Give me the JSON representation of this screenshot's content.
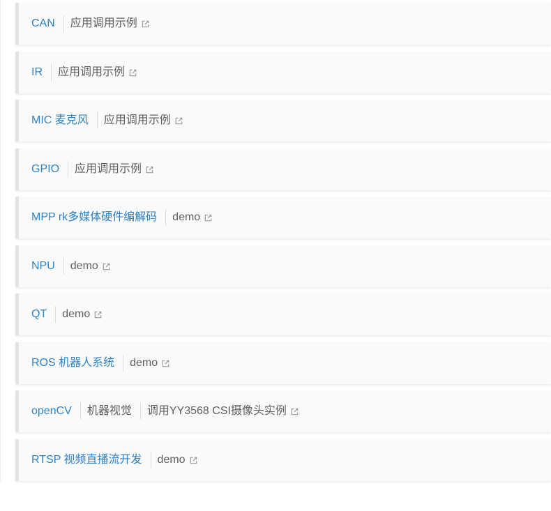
{
  "items": [
    {
      "title": "CAN",
      "parts": [
        {
          "text": "应用调用示例"
        }
      ]
    },
    {
      "title": "IR",
      "parts": [
        {
          "text": "应用调用示例"
        }
      ]
    },
    {
      "title": "MIC 麦克风",
      "parts": [
        {
          "text": "应用调用示例"
        }
      ]
    },
    {
      "title": "GPIO",
      "parts": [
        {
          "text": "应用调用示例"
        }
      ]
    },
    {
      "title": "MPP rk多媒体硬件编解码",
      "parts": [
        {
          "text": "demo"
        }
      ]
    },
    {
      "title": "NPU",
      "parts": [
        {
          "text": "demo"
        }
      ]
    },
    {
      "title": "QT",
      "parts": [
        {
          "text": "demo"
        }
      ]
    },
    {
      "title": "ROS 机器人系统",
      "parts": [
        {
          "text": "demo"
        }
      ]
    },
    {
      "title": "openCV",
      "parts": [
        {
          "text": "机器视觉"
        },
        {
          "text": "调用YY3568 CSI摄像头实例"
        }
      ]
    },
    {
      "title": "RTSP 视频直播流开发",
      "parts": [
        {
          "text": "demo"
        }
      ]
    }
  ],
  "icons": {
    "external": "external-link-icon"
  },
  "colors": {
    "link": "#2d82c8",
    "text": "#5f5f5f",
    "card": "#fafafa",
    "border": "#e3e3e3",
    "icon": "#9a9a9a"
  }
}
